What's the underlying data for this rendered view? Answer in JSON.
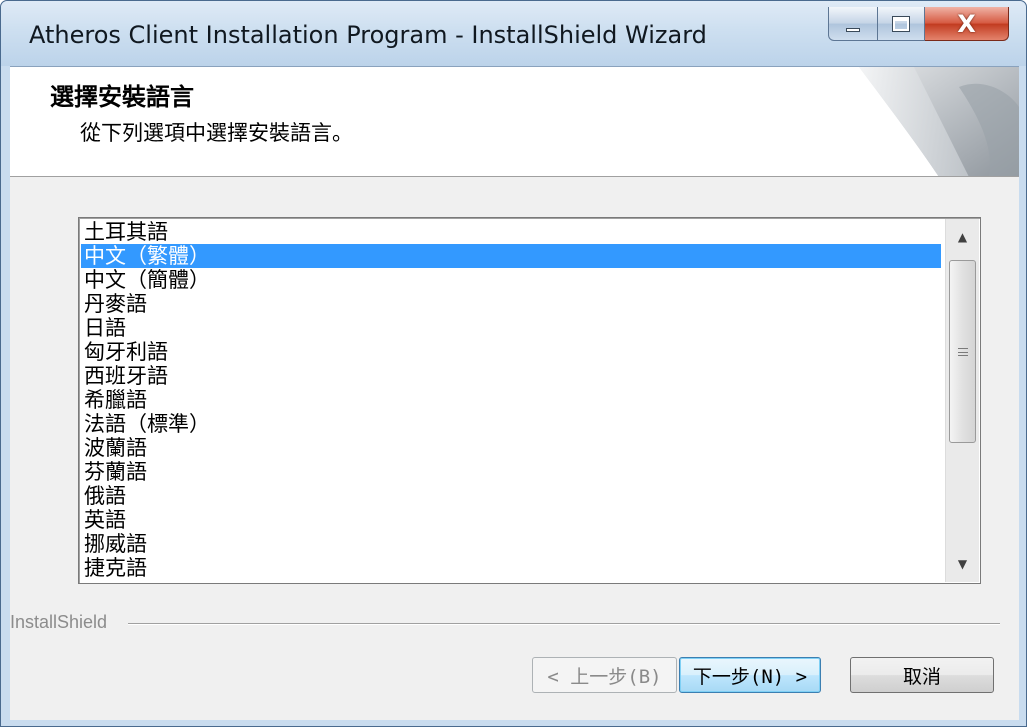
{
  "window": {
    "title": "Atheros Client Installation Program - InstallShield Wizard",
    "close_symbol": "X"
  },
  "header": {
    "title": "選擇安裝語言",
    "subtitle": "從下列選項中選擇安裝語言。"
  },
  "language_list": {
    "items": [
      "土耳其語",
      "中文（繁體）",
      "中文（簡體）",
      "丹麥語",
      "日語",
      "匈牙利語",
      "西班牙語",
      "希臘語",
      "法語（標準）",
      "波蘭語",
      "芬蘭語",
      "俄語",
      "英語",
      "挪威語",
      "捷克語"
    ],
    "selected_index": 1
  },
  "footer": {
    "brand": "InstallShield",
    "back_label": "< 上一步(B)",
    "next_label": "下一步(N) >",
    "cancel_label": "取消"
  },
  "colors": {
    "selection": "#3399ff",
    "window_frame": "#c9dcef",
    "close_button": "#c13a1f"
  }
}
